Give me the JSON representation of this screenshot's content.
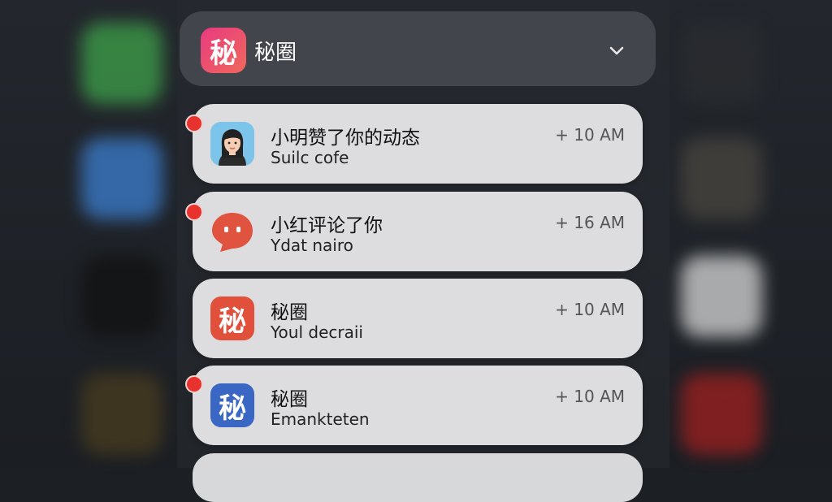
{
  "group": {
    "icon_char": "秘",
    "title": "秘圈",
    "expand_icon": "chevron-down-icon"
  },
  "notifications": [
    {
      "icon": "avatar-woman",
      "title": "小明赞了你的动态",
      "body": "Suilc cofe",
      "time": "+ 10 AM",
      "unread": true
    },
    {
      "icon": "chat-bubble-icon",
      "title": "小红评论了你",
      "body": "Ydat nairo",
      "time": "+ 16 AM",
      "unread": true
    },
    {
      "icon": "app-icon-red",
      "icon_char": "秘",
      "title": "秘圈",
      "body": "Youl decraii",
      "time": "+ 10 AM",
      "unread": false
    },
    {
      "icon": "app-icon-blue",
      "icon_char": "秘",
      "title": "秘圈",
      "body": "Emankteten",
      "time": "+ 10 AM",
      "unread": true
    }
  ],
  "colors": {
    "unread_dot": "#e8322e",
    "app_red": "#e0503a",
    "app_blue": "#3a66c4",
    "chat_red": "#e0533e"
  }
}
